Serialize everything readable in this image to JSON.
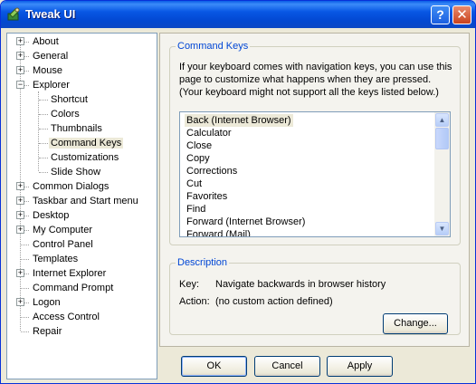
{
  "window": {
    "title": "Tweak UI",
    "help_label": "?",
    "close_label": "✕"
  },
  "tree": {
    "items": [
      {
        "label": "About",
        "level": 0,
        "expander": "+"
      },
      {
        "label": "General",
        "level": 0,
        "expander": "+"
      },
      {
        "label": "Mouse",
        "level": 0,
        "expander": "+"
      },
      {
        "label": "Explorer",
        "level": 0,
        "expander": "−"
      },
      {
        "label": "Shortcut",
        "level": 1,
        "expander": ""
      },
      {
        "label": "Colors",
        "level": 1,
        "expander": ""
      },
      {
        "label": "Thumbnails",
        "level": 1,
        "expander": ""
      },
      {
        "label": "Command Keys",
        "level": 1,
        "expander": "",
        "selected": true
      },
      {
        "label": "Customizations",
        "level": 1,
        "expander": ""
      },
      {
        "label": "Slide Show",
        "level": 1,
        "expander": ""
      },
      {
        "label": "Common Dialogs",
        "level": 0,
        "expander": "+"
      },
      {
        "label": "Taskbar and Start menu",
        "level": 0,
        "expander": "+"
      },
      {
        "label": "Desktop",
        "level": 0,
        "expander": "+"
      },
      {
        "label": "My Computer",
        "level": 0,
        "expander": "+"
      },
      {
        "label": "Control Panel",
        "level": 0,
        "expander": ""
      },
      {
        "label": "Templates",
        "level": 0,
        "expander": ""
      },
      {
        "label": "Internet Explorer",
        "level": 0,
        "expander": "+"
      },
      {
        "label": "Command Prompt",
        "level": 0,
        "expander": ""
      },
      {
        "label": "Logon",
        "level": 0,
        "expander": "+"
      },
      {
        "label": "Access Control",
        "level": 0,
        "expander": ""
      },
      {
        "label": "Repair",
        "level": 0,
        "expander": ""
      }
    ]
  },
  "command_keys": {
    "group_title": "Command Keys",
    "intro": "If your keyboard comes with navigation keys, you can use this page to customize what happens when they are pressed. (Your keyboard might not support all the keys listed below.)",
    "list": [
      {
        "label": "Back (Internet Browser)",
        "selected": true
      },
      {
        "label": "Calculator"
      },
      {
        "label": "Close"
      },
      {
        "label": "Copy"
      },
      {
        "label": "Corrections"
      },
      {
        "label": "Cut"
      },
      {
        "label": "Favorites"
      },
      {
        "label": "Find"
      },
      {
        "label": "Forward (Internet Browser)"
      },
      {
        "label": "Forward (Mail)"
      }
    ]
  },
  "description": {
    "group_title": "Description",
    "key_label": "Key:",
    "key_value": "Navigate backwards in browser history",
    "action_label": "Action:",
    "action_value": "(no custom action defined)",
    "change_label": "Change..."
  },
  "footer": {
    "ok_label": "OK",
    "cancel_label": "Cancel",
    "apply_label": "Apply"
  }
}
